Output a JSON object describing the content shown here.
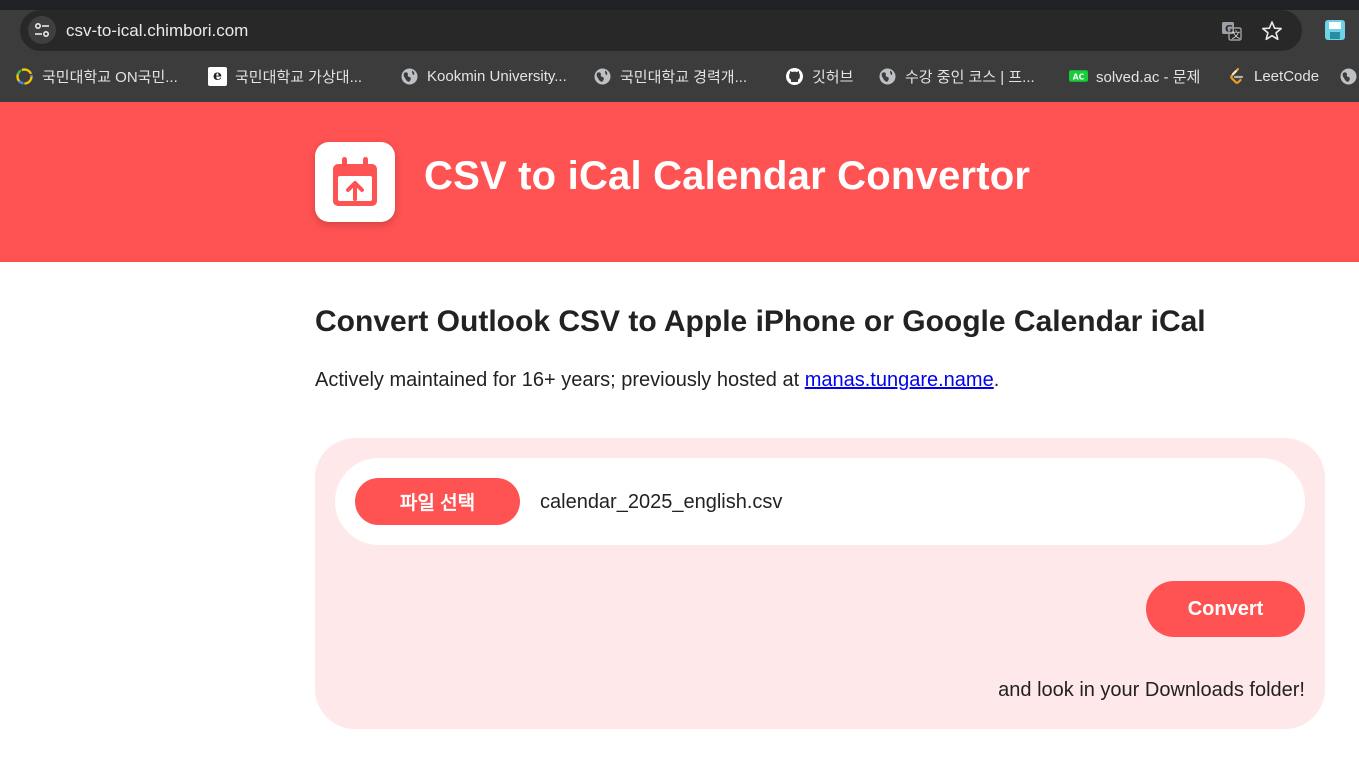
{
  "browser": {
    "url": "csv-to-ical.chimbori.com",
    "bookmarks": [
      {
        "label": "국민대학교 ON국민...",
        "icon": "kookmin-on-icon"
      },
      {
        "label": "국민대학교 가상대...",
        "icon": "ecampus-icon"
      },
      {
        "label": "Kookmin University...",
        "icon": "globe-icon"
      },
      {
        "label": "국민대학교 경력개...",
        "icon": "globe-icon"
      },
      {
        "label": "깃허브",
        "icon": "github-icon"
      },
      {
        "label": "수강 중인 코스 | 프...",
        "icon": "globe-icon"
      },
      {
        "label": "solved.ac - 문제",
        "icon": "solvedac-icon"
      },
      {
        "label": "LeetCode",
        "icon": "leetcode-icon"
      }
    ],
    "ecampus_mark": "e"
  },
  "header": {
    "title": "CSV to iCal Calendar Convertor",
    "bg_color": "#ff5252"
  },
  "main": {
    "heading": "Convert Outlook CSV to Apple iPhone or Google Calendar iCal",
    "sub_prefix": "Actively maintained for 16+ years; previously hosted at ",
    "sub_link": "manas.tungare.name",
    "sub_suffix": "."
  },
  "form": {
    "file_button_label": "파일 선택",
    "file_name": "calendar_2025_english.csv",
    "convert_label": "Convert",
    "footnote": "and look in your Downloads folder!"
  }
}
